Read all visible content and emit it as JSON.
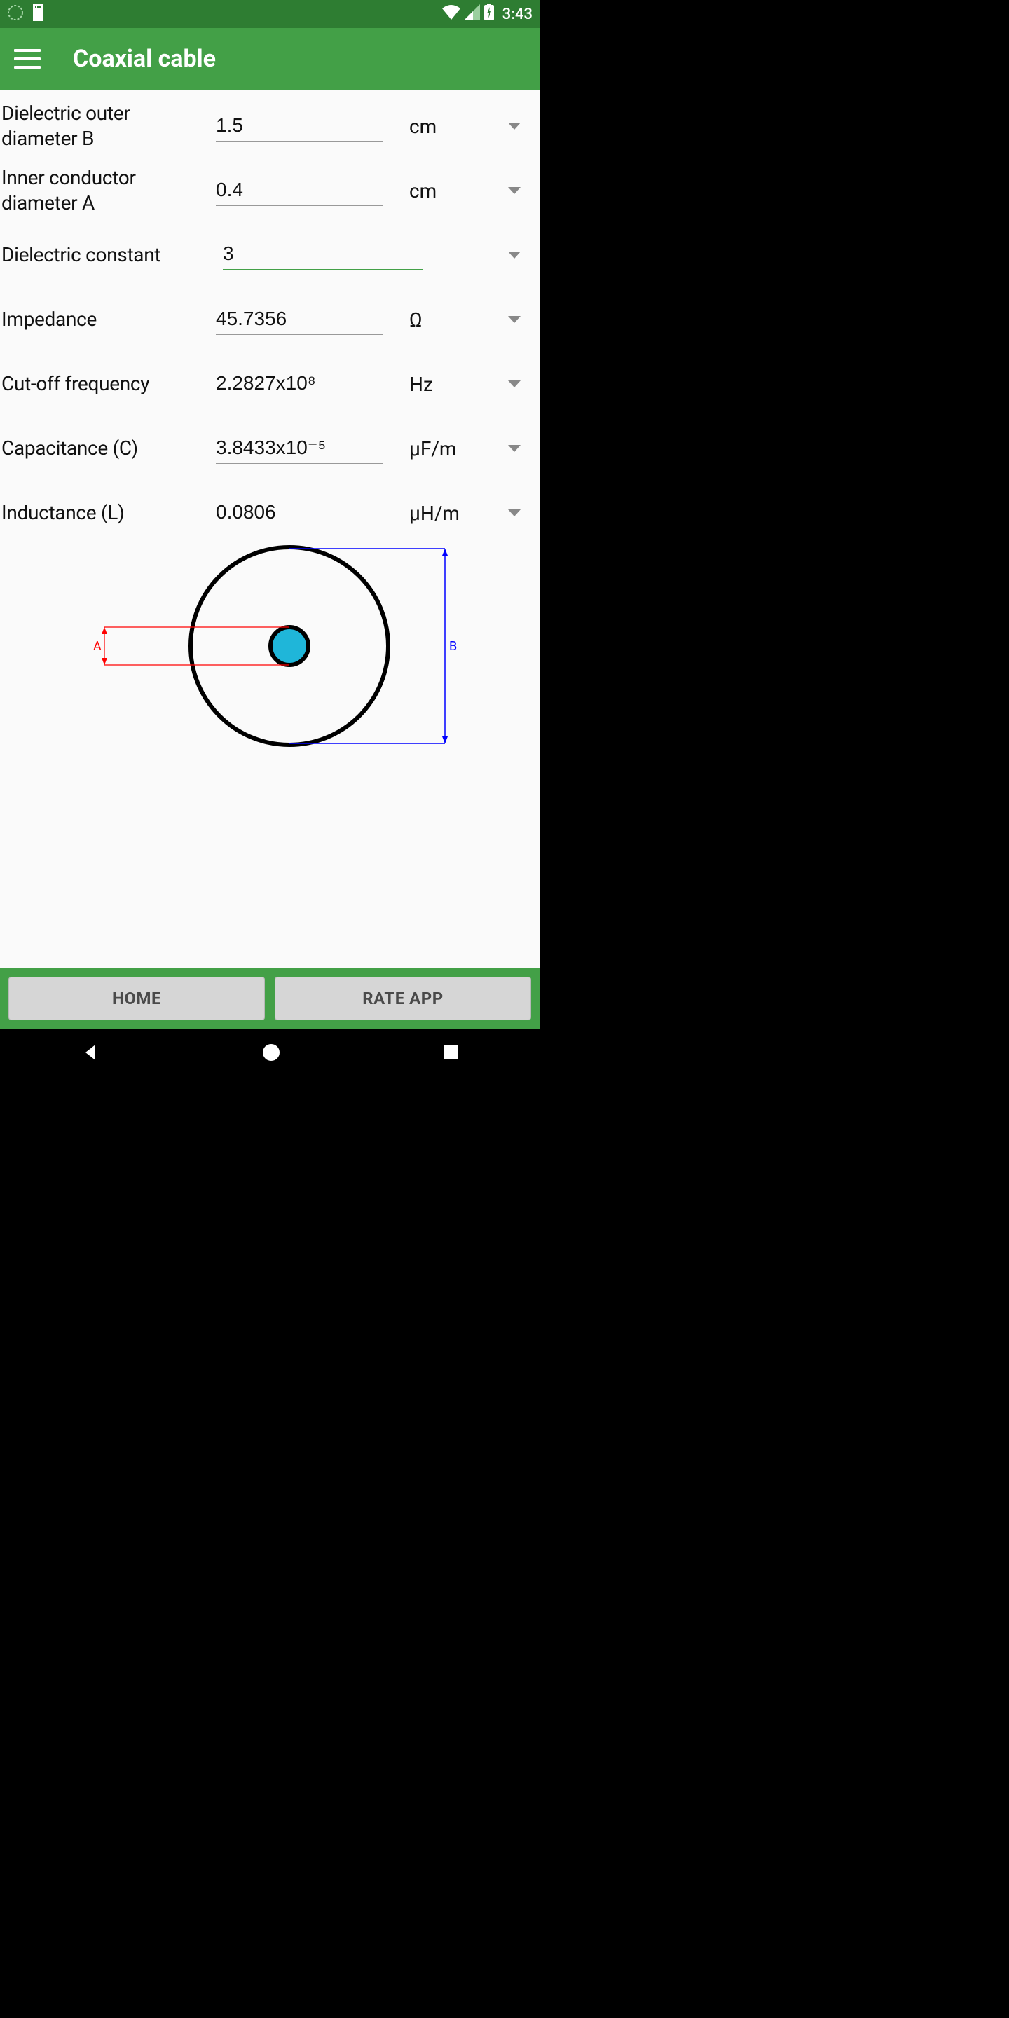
{
  "status": {
    "time": "3:43"
  },
  "appbar": {
    "title": "Coaxial cable"
  },
  "fields": {
    "dielectric_outer": {
      "label": "Dielectric outer diameter B",
      "value": "1.5",
      "unit": "cm"
    },
    "inner_conductor": {
      "label": "Inner conductor diameter A",
      "value": "0.4",
      "unit": "cm"
    },
    "dielectric_constant": {
      "label": "Dielectric constant",
      "value": "3",
      "unit": ""
    },
    "impedance": {
      "label": "Impedance",
      "value": "45.7356",
      "unit": "Ω"
    },
    "cutoff": {
      "label": "Cut-off frequency",
      "value": "2.2827x10⁸",
      "unit": "Hz"
    },
    "capacitance": {
      "label": "Capacitance (C)",
      "value": "3.8433x10⁻⁵",
      "unit": "μF/m"
    },
    "inductance": {
      "label": "Inductance (L)",
      "value": "0.0806",
      "unit": "μH/m"
    }
  },
  "diagram": {
    "label_a": "A",
    "label_b": "B"
  },
  "buttons": {
    "home": "HOME",
    "rate": "RATE APP"
  }
}
